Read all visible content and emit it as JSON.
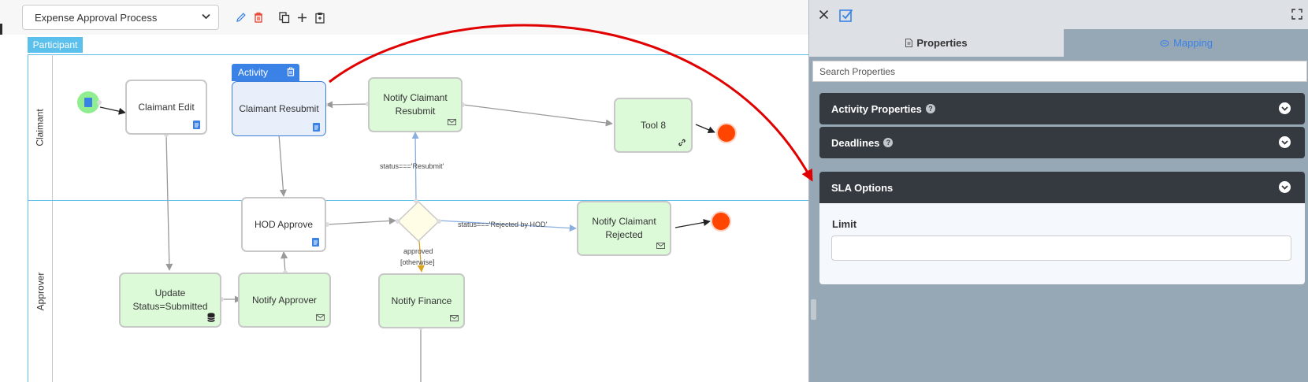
{
  "toolbar": {
    "process_selected": "Expense Approval Process",
    "edit_tool": "pencil-icon",
    "delete_tool": "trash-icon",
    "copy_tool": "copy-icon",
    "add_tool": "plus-icon",
    "paste_tool": "clipboard-icon"
  },
  "canvas": {
    "participant_label": "Participant",
    "lanes": [
      {
        "label": "Claimant"
      },
      {
        "label": "Approver"
      }
    ],
    "activity_badge": "Activity",
    "nodes": {
      "claimant_edit": "Claimant Edit",
      "claimant_resubmit": "Claimant Resubmit",
      "notify_claimant_resubmit": "Notify Claimant Resubmit",
      "tool_8": "Tool 8",
      "hod_approve": "HOD Approve",
      "update_status": "Update Status=Submitted",
      "notify_approver": "Notify Approver",
      "notify_finance": "Notify Finance",
      "notify_claimant_rejected": "Notify Claimant Rejected"
    },
    "edge_labels": {
      "resubmit": "status==='Resubmit'",
      "rejected": "status==='Rejected by HOD'",
      "approved": "approved",
      "otherwise": "[otherwise]"
    },
    "colors": {
      "lane_border": "#5bc0eb",
      "task_fill": "#dcfad8",
      "selected_fill": "#e8effa",
      "end_event": "#ff4500",
      "start_event": "#90ee90",
      "gateway_fill": "#fffde5",
      "annotation_arrow": "#e00000"
    }
  },
  "panel": {
    "close_icon": "close-icon",
    "confirm_icon": "checkbox-icon",
    "expand_icon": "expand-icon",
    "tabs": [
      {
        "label": "Properties",
        "icon": "document-icon"
      },
      {
        "label": "Mapping",
        "icon": "link-icon"
      }
    ],
    "search_placeholder": "Search Properties",
    "sections": [
      {
        "label": "Activity Properties",
        "has_help": true
      },
      {
        "label": "Deadlines",
        "has_help": true
      },
      {
        "label": "SLA Options",
        "has_help": false
      }
    ],
    "sla": {
      "limit_label": "Limit",
      "limit_value": ""
    }
  }
}
